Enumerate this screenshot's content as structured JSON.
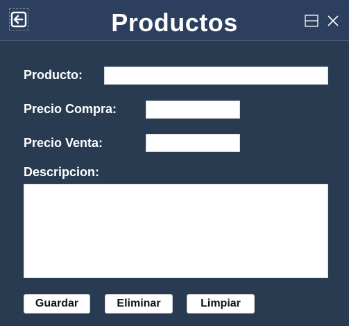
{
  "window": {
    "title": "Productos",
    "icons": {
      "back": "back-arrow-icon",
      "minimize": "minimize-icon",
      "close": "close-icon"
    },
    "colors": {
      "background": "#283b51",
      "titlebar": "#2c3f5f",
      "text": "#ffffff"
    }
  },
  "form": {
    "producto": {
      "label": "Producto:",
      "value": "",
      "placeholder": ""
    },
    "precio_compra": {
      "label": "Precio Compra:",
      "value": "",
      "placeholder": ""
    },
    "precio_venta": {
      "label": "Precio Venta:",
      "value": "",
      "placeholder": ""
    },
    "descripcion": {
      "label": "Descripcion:",
      "value": "",
      "placeholder": ""
    }
  },
  "actions": {
    "guardar": "Guardar",
    "eliminar": "Eliminar",
    "limpiar": "Limpiar"
  }
}
